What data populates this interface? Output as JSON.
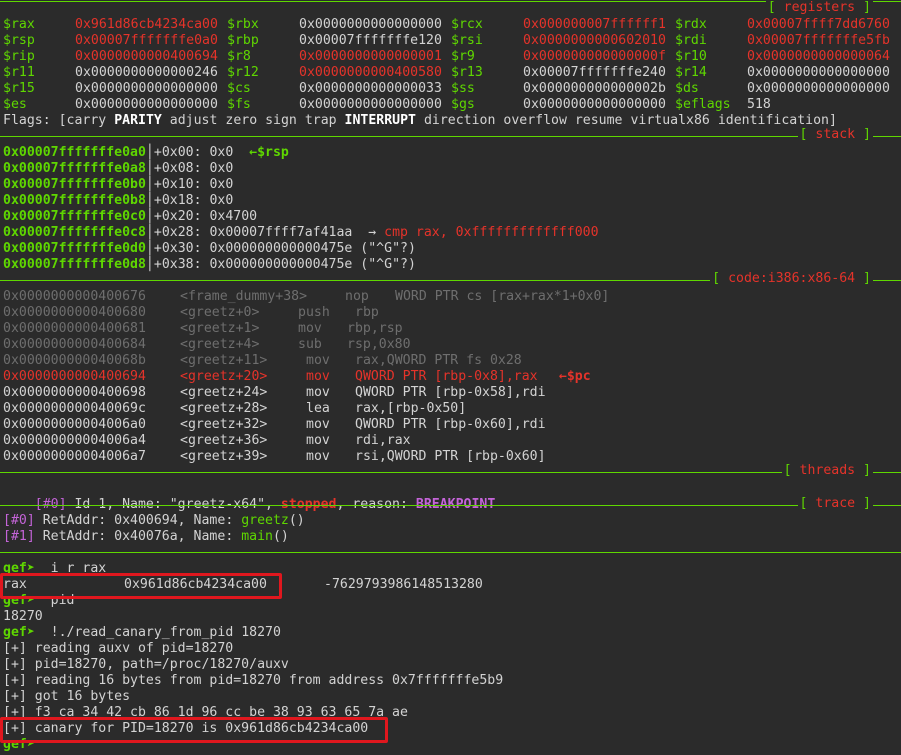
{
  "sections": {
    "registers": "registers",
    "stack": "stack",
    "code": "code:i386:x86-64",
    "threads": "threads",
    "trace": "trace"
  },
  "registers": [
    [
      {
        "n": "$rax",
        "v": "0x961d86cb4234ca00",
        "c": "red"
      },
      {
        "n": "$rbx",
        "v": "0x0000000000000000",
        "c": "plain"
      },
      {
        "n": "$rcx",
        "v": "0x000000007ffffff1",
        "c": "red"
      },
      {
        "n": "$rdx",
        "v": "0x00007ffff7dd6760",
        "c": "red"
      }
    ],
    [
      {
        "n": "$rsp",
        "v": "0x00007fffffffe0a0",
        "c": "red"
      },
      {
        "n": "$rbp",
        "v": "0x00007fffffffe120",
        "c": "plain"
      },
      {
        "n": "$rsi",
        "v": "0x0000000000602010",
        "c": "red"
      },
      {
        "n": "$rdi",
        "v": "0x00007fffffffe5fb",
        "c": "red"
      }
    ],
    [
      {
        "n": "$rip",
        "v": "0x0000000000400694",
        "c": "red"
      },
      {
        "n": "$r8",
        "v": "0x0000000000000001",
        "c": "red"
      },
      {
        "n": "$r9",
        "v": "0x000000000000000f",
        "c": "red"
      },
      {
        "n": "$r10",
        "v": "0x0000000000000064",
        "c": "red"
      }
    ],
    [
      {
        "n": "$r11",
        "v": "0x0000000000000246",
        "c": "plain"
      },
      {
        "n": "$r12",
        "v": "0x0000000000400580",
        "c": "red"
      },
      {
        "n": "$r13",
        "v": "0x00007fffffffe240",
        "c": "plain"
      },
      {
        "n": "$r14",
        "v": "0x0000000000000000",
        "c": "plain"
      }
    ],
    [
      {
        "n": "$r15",
        "v": "0x0000000000000000",
        "c": "plain"
      },
      {
        "n": "$cs",
        "v": "0x0000000000000033",
        "c": "plain"
      },
      {
        "n": "$ss",
        "v": "0x000000000000002b",
        "c": "plain"
      },
      {
        "n": "$ds",
        "v": "0x0000000000000000",
        "c": "plain"
      }
    ],
    [
      {
        "n": "$es",
        "v": "0x0000000000000000",
        "c": "plain"
      },
      {
        "n": "$fs",
        "v": "0x0000000000000000",
        "c": "plain"
      },
      {
        "n": "$gs",
        "v": "0x0000000000000000",
        "c": "plain"
      },
      {
        "n": "$eflags",
        "v": "518",
        "c": "plain"
      }
    ]
  ],
  "flags": {
    "prefix": "Flags: [",
    "items": [
      {
        "t": "carry",
        "b": false
      },
      {
        "t": "PARITY",
        "b": true
      },
      {
        "t": "adjust",
        "b": false
      },
      {
        "t": "zero",
        "b": false
      },
      {
        "t": "sign",
        "b": false
      },
      {
        "t": "trap",
        "b": false
      },
      {
        "t": "INTERRUPT",
        "b": true
      },
      {
        "t": "direction",
        "b": false
      },
      {
        "t": "overflow",
        "b": false
      },
      {
        "t": "resume",
        "b": false
      },
      {
        "t": "virtualx86",
        "b": false
      },
      {
        "t": "identification",
        "b": false
      }
    ],
    "suffix": "]"
  },
  "stack": [
    {
      "addr": "0x00007fffffffe0a0",
      "off": "+0x00:",
      "val": " 0x0",
      "note": "  ←$rsp",
      "noteColor": "green"
    },
    {
      "addr": "0x00007fffffffe0a8",
      "off": "+0x08:",
      "val": " 0x0",
      "note": "",
      "noteColor": ""
    },
    {
      "addr": "0x00007fffffffe0b0",
      "off": "+0x10:",
      "val": " 0x0",
      "note": "",
      "noteColor": ""
    },
    {
      "addr": "0x00007fffffffe0b8",
      "off": "+0x18:",
      "val": " 0x0",
      "note": "",
      "noteColor": ""
    },
    {
      "addr": "0x00007fffffffe0c0",
      "off": "+0x20:",
      "val": " 0x4700",
      "note": "",
      "noteColor": ""
    },
    {
      "addr": "0x00007fffffffe0c8",
      "off": "+0x28:",
      "val": " 0x00007ffff7af41aa  → ",
      "note": "cmp rax, 0xfffffffffffff000",
      "noteColor": "red"
    },
    {
      "addr": "0x00007fffffffe0d0",
      "off": "+0x30:",
      "val": " 0x000000000000475e (\"^G\"?)",
      "note": "",
      "noteColor": ""
    },
    {
      "addr": "0x00007fffffffe0d8",
      "off": "+0x38:",
      "val": " 0x000000000000475e (\"^G\"?)",
      "note": "",
      "noteColor": ""
    }
  ],
  "code": [
    {
      "addr": "0x0000000000400676",
      "sym": "<frame_dummy+38>",
      "mn": "nop",
      "op": "WORD PTR cs [rax+rax*1+0x0]",
      "state": "dim",
      "mnx": 345,
      "opx": 395
    },
    {
      "addr": "0x0000000000400680",
      "sym": "<greetz+0>",
      "mn": "push",
      "op": "rbp",
      "state": "dim",
      "mnx": 298,
      "opx": 355
    },
    {
      "addr": "0x0000000000400681",
      "sym": "<greetz+1>",
      "mn": "mov",
      "op": "rbp,rsp",
      "state": "dim",
      "mnx": 298,
      "opx": 347
    },
    {
      "addr": "0x0000000000400684",
      "sym": "<greetz+4>",
      "mn": "sub",
      "op": "rsp,0x80",
      "state": "dim",
      "mnx": 298,
      "opx": 347
    },
    {
      "addr": "0x000000000040068b",
      "sym": "<greetz+11>",
      "mn": "mov",
      "op": "rax,QWORD PTR fs 0x28",
      "state": "dim",
      "mnx": 306,
      "opx": 355
    },
    {
      "addr": "0x0000000000400694",
      "sym": "<greetz+20>",
      "mn": "mov",
      "op": "QWORD PTR [rbp-0x8],rax",
      "state": "cur",
      "mnx": 306,
      "opx": 355,
      "note": "  ←$pc"
    },
    {
      "addr": "0x0000000000400698",
      "sym": "<greetz+24>",
      "mn": "mov",
      "op": "QWORD PTR [rbp-0x58],rdi",
      "state": "plain",
      "mnx": 306,
      "opx": 355
    },
    {
      "addr": "0x000000000040069c",
      "sym": "<greetz+28>",
      "mn": "lea",
      "op": "rax,[rbp-0x50]",
      "state": "plain",
      "mnx": 306,
      "opx": 355
    },
    {
      "addr": "0x00000000004006a0",
      "sym": "<greetz+32>",
      "mn": "mov",
      "op": "QWORD PTR [rbp-0x60],rdi",
      "state": "plain",
      "mnx": 306,
      "opx": 355
    },
    {
      "addr": "0x00000000004006a4",
      "sym": "<greetz+36>",
      "mn": "mov",
      "op": "rdi,rax",
      "state": "plain",
      "mnx": 306,
      "opx": 355
    },
    {
      "addr": "0x00000000004006a7",
      "sym": "<greetz+39>",
      "mn": "mov",
      "op": "rsi,QWORD PTR [rbp-0x60]",
      "state": "plain",
      "mnx": 306,
      "opx": 355
    }
  ],
  "threads": {
    "idx": "[#0]",
    "text": " Id 1, Name: \"greetz-x64\", ",
    "state": "stopped",
    "mid": ", reason: ",
    "reason": "BREAKPOINT"
  },
  "trace": [
    {
      "idx": "[#0]",
      "text": " RetAddr: 0x400694, Name: ",
      "fn": "greetz",
      "end": "()"
    },
    {
      "idx": "[#1]",
      "text": " RetAddr: 0x40076a, Name: ",
      "fn": "main",
      "end": "()"
    }
  ],
  "console": [
    {
      "type": "prompt",
      "prompt": "gef➤ ",
      "cmd": " i r rax"
    },
    {
      "type": "rax",
      "name": "rax",
      "hex": "0x961d86cb4234ca00",
      "dec": "-7629793986148513280"
    },
    {
      "type": "prompt",
      "prompt": "gef➤ ",
      "cmd": " pid"
    },
    {
      "type": "out",
      "text": "18270"
    },
    {
      "type": "prompt",
      "prompt": "gef➤ ",
      "cmd": " !./read_canary_from_pid 18270"
    },
    {
      "type": "out",
      "text": "[+] reading auxv of pid=18270"
    },
    {
      "type": "out",
      "text": "[+] pid=18270, path=/proc/18270/auxv"
    },
    {
      "type": "out",
      "text": "[+] reading 16 bytes from pid=18270 from address 0x7fffffffe5b9"
    },
    {
      "type": "out",
      "text": "[+] got 16 bytes"
    },
    {
      "type": "out",
      "text": "[+] f3 ca 34 42 cb 86 1d 96 cc be 38 93 63 65 7a ae"
    },
    {
      "type": "out",
      "text": "[+] canary for PID=18270 is 0x961d86cb4234ca00"
    },
    {
      "type": "prompt",
      "prompt": "gef➤ ",
      "cmd": ""
    }
  ],
  "colors": {
    "green": "#5fd700",
    "red": "#e5332a",
    "dim": "#6e6e6e",
    "bg": "#2b2b2b",
    "highlight": "#e0171e"
  }
}
